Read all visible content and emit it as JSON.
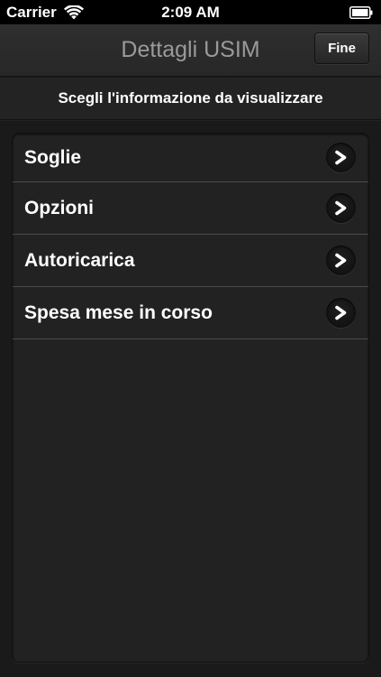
{
  "status_bar": {
    "carrier": "Carrier",
    "time": "2:09 AM",
    "wifi_icon": "wifi-icon",
    "battery_icon": "battery-icon"
  },
  "nav_bar": {
    "title": "Dettagli USIM",
    "done_label": "Fine"
  },
  "subheader": {
    "text": "Scegli l'informazione da visualizzare"
  },
  "list": {
    "items": [
      {
        "label": "Soglie",
        "icon": "chevron-right-icon"
      },
      {
        "label": "Opzioni",
        "icon": "chevron-right-icon"
      },
      {
        "label": "Autoricarica",
        "icon": "chevron-right-icon"
      },
      {
        "label": "Spesa mese in corso",
        "icon": "chevron-right-icon"
      }
    ]
  },
  "colors": {
    "background": "#1a1a1a",
    "nav_title": "#9a9a9a",
    "separator": "#4a4a4a",
    "text": "#ffffff"
  }
}
